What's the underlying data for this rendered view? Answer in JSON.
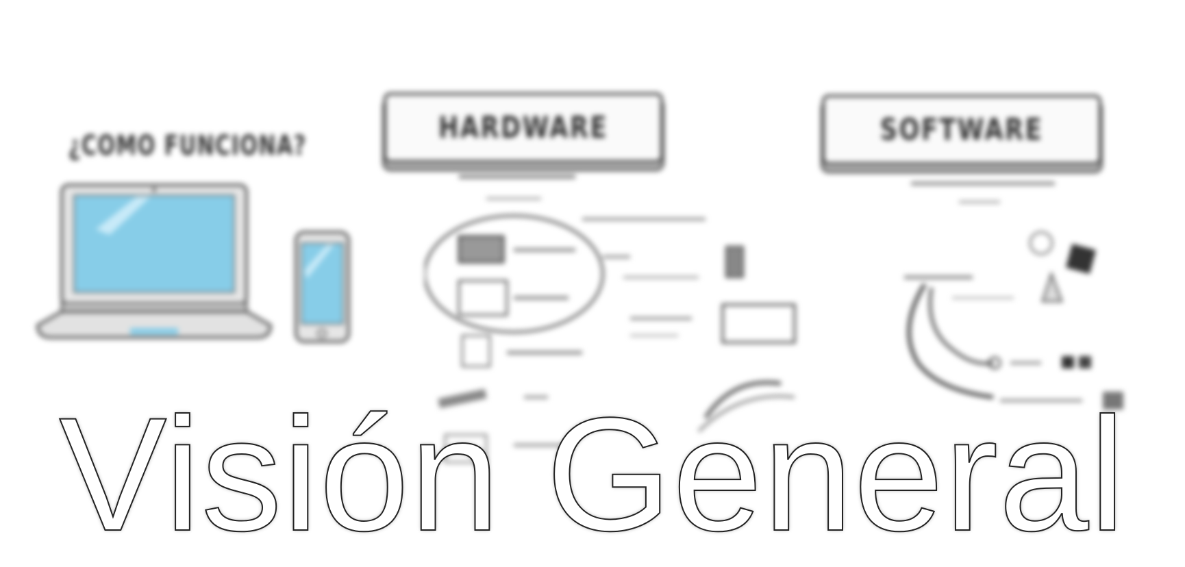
{
  "title": "Visión General",
  "backdrop": {
    "question": "¿COMO FUNCIONA?",
    "hardware_banner": "HARDWARE",
    "software_banner": "SOFTWARE"
  },
  "colors": {
    "background": "#ffffff",
    "screen_blue": "#87cde8",
    "ink": "#333333",
    "title_fill": "#ffffff",
    "title_stroke": "#222222"
  }
}
